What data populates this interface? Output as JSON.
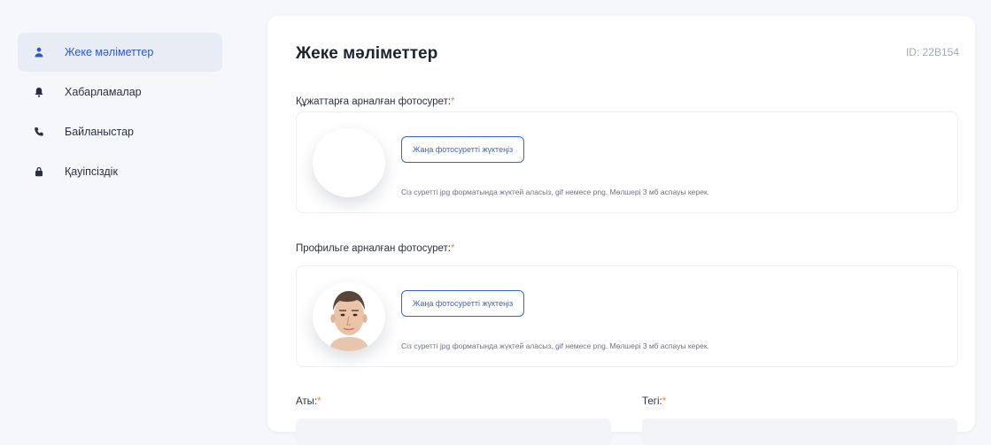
{
  "sidebar": {
    "items": [
      {
        "label": "Жеке мәліметтер",
        "icon": "user-icon",
        "active": true
      },
      {
        "label": "Хабарламалар",
        "icon": "bell-icon",
        "active": false
      },
      {
        "label": "Байланыстар",
        "icon": "phone-icon",
        "active": false
      },
      {
        "label": "Қауіпсіздік",
        "icon": "lock-icon",
        "active": false
      }
    ]
  },
  "main": {
    "title": "Жеке мәліметтер",
    "id_text": "ID: 22B154",
    "document_photo": {
      "label": "Құжаттарға арналған фотосурет:",
      "required_mark": "*",
      "upload_label": "Жаңа фотосуретті жүктеңіз",
      "hint": "Сіз суретті jpg форматында жүктей аласыз, gif немесе png. Мөлшері 3 мб аспауы керек."
    },
    "profile_photo": {
      "label": "Профильге арналған фотосурет:",
      "required_mark": "*",
      "upload_label": "Жаңа фотосуретті жүктеңіз",
      "hint": "Сіз суретті jpg форматында жүктей аласыз, gif немесе png. Мөлшері 3 мб аспауы керек."
    },
    "fields": {
      "first_name_label": "Аты:",
      "last_name_label": "Тегі:",
      "required_mark": "*"
    }
  },
  "colors": {
    "accent": "#3d63c9",
    "required": "#f08a32",
    "active_bg": "#e8ecf5"
  }
}
